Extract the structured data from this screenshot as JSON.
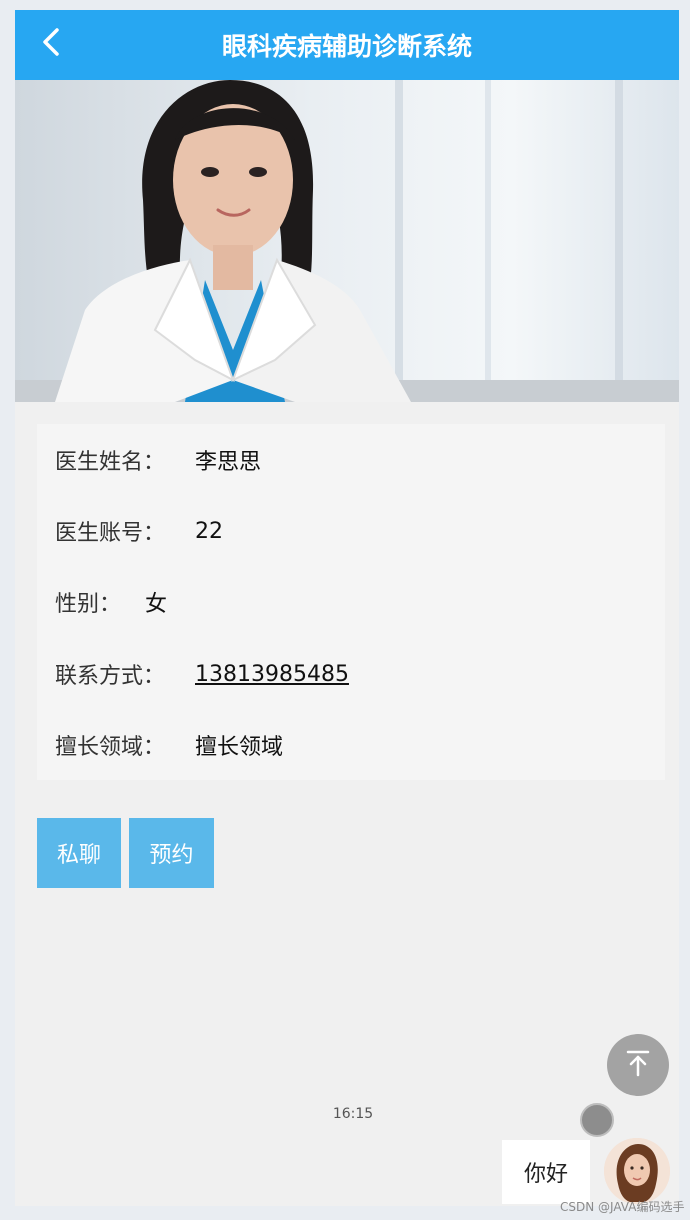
{
  "header": {
    "title": "眼科疾病辅助诊断系统",
    "back_icon": "chevron-left-icon"
  },
  "doctor": {
    "name_label": "医生姓名：",
    "name_value": "李思思",
    "account_label": "医生账号：",
    "account_value": "22",
    "gender_label": "性别：",
    "gender_value": "女",
    "contact_label": "联系方式：",
    "contact_value": "13813985485",
    "specialty_label": "擅长领域：",
    "specialty_value": "擅长领域"
  },
  "actions": {
    "chat_label": "私聊",
    "appointment_label": "预约"
  },
  "chat": {
    "timestamp": "16:15",
    "message": "你好"
  },
  "watermark": "CSDN @JAVA编码选手",
  "colors": {
    "header": "#27a7f2",
    "button": "#5ab8ea",
    "scroll_top": "#a3a3a3"
  }
}
